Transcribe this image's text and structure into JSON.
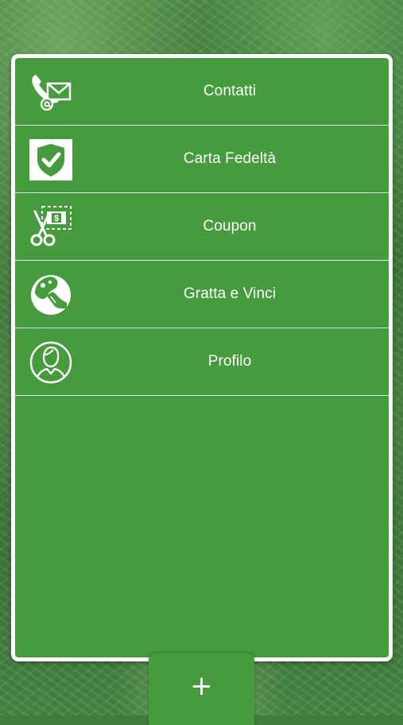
{
  "menu": {
    "items": [
      {
        "label": "Contatti",
        "icon": "phone-email-icon"
      },
      {
        "label": "Carta Fedeltà",
        "icon": "shield-check-icon"
      },
      {
        "label": "Coupon",
        "icon": "scissors-coupon-icon"
      },
      {
        "label": "Gratta e Vinci",
        "icon": "scratch-card-icon"
      },
      {
        "label": "Profilo",
        "icon": "user-profile-icon"
      }
    ]
  },
  "footer": {
    "plus_label": "+"
  },
  "colors": {
    "panel": "#459b3d",
    "border": "#ffffff",
    "text": "#ffffff"
  }
}
